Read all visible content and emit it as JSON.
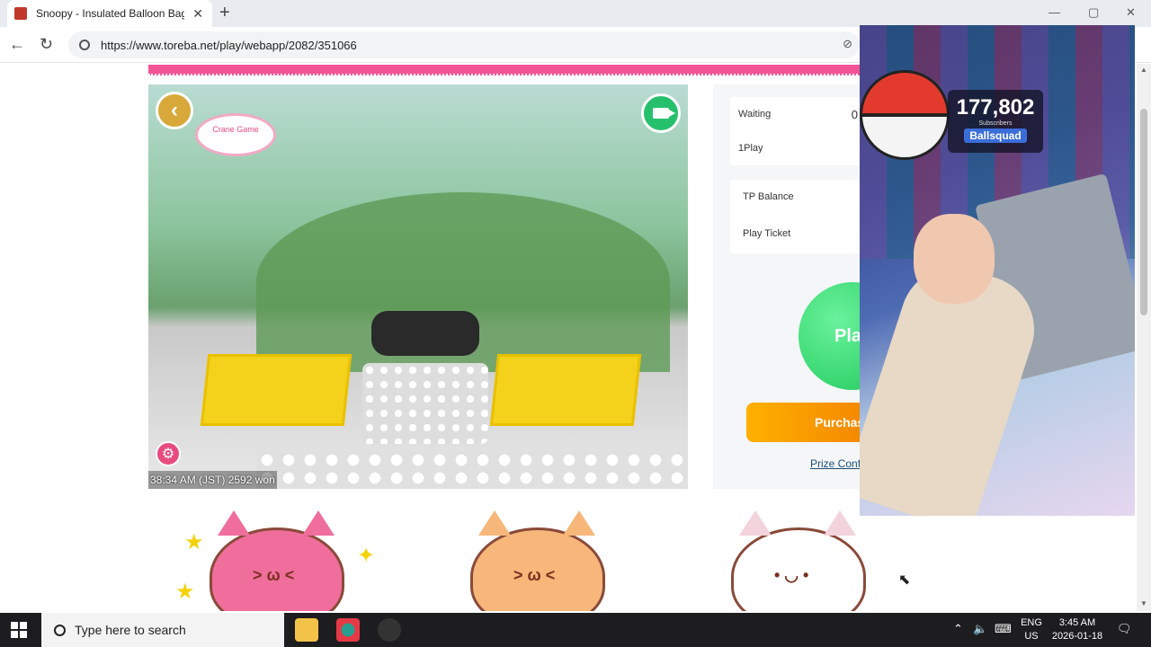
{
  "browser": {
    "tab_title": "Snoopy - Insulated Balloon Bag S",
    "url": "https://www.toreba.net/play/webapp/2082/351066",
    "new_tab_label": "+",
    "close_tab_label": "✕"
  },
  "game": {
    "caption": "38:34 AM (JST) 2592 won",
    "logo_text": "Crane Game"
  },
  "panel": {
    "waiting_label": "Waiting",
    "waiting_value": "0",
    "one_play_label": "1Play",
    "tp_balance_label": "TP Balance",
    "play_ticket_label": "Play Ticket",
    "play_button_label": "Pla",
    "purchase_button_label": "Purchas",
    "prize_link_label": "Prize Confi"
  },
  "overlay": {
    "subscriber_count": "177,802",
    "subscriber_label": "Subscribers",
    "channel_name": "Ballsquad"
  },
  "taskbar": {
    "search_placeholder": "Type here to search",
    "lang_top": "ENG",
    "lang_bottom": "US",
    "time": "3:45 AM",
    "date": "2026-01-18"
  },
  "colors": {
    "accent_pink": "#f25596",
    "play_green": "#1ec85a",
    "purchase_orange": "#f07a00"
  }
}
